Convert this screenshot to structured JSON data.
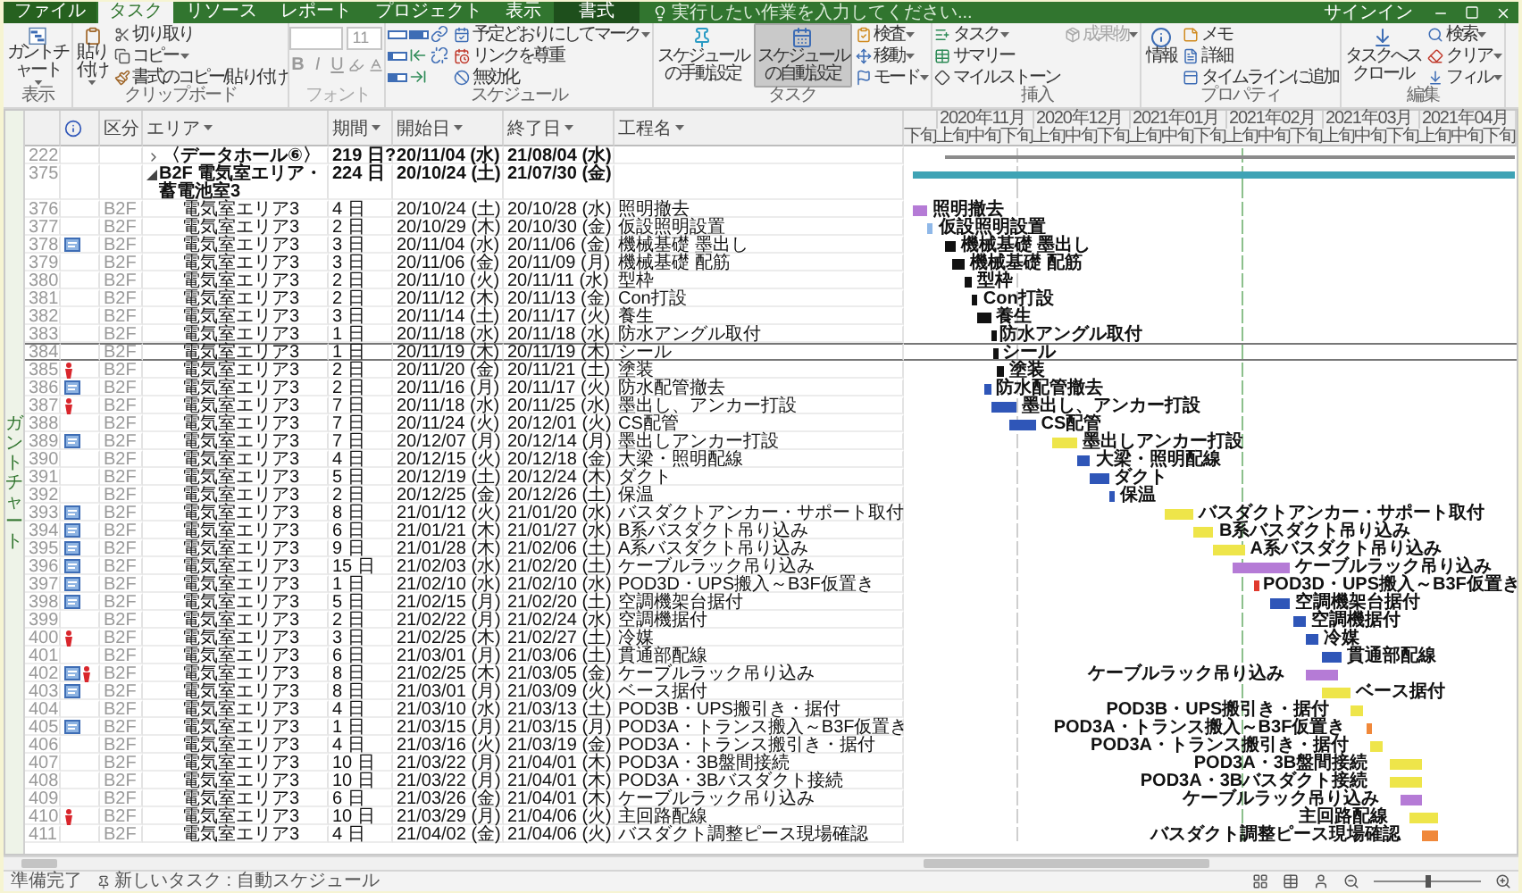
{
  "tabs": [
    {
      "label": "ファイル",
      "kind": "file",
      "selected": false
    },
    {
      "label": "タスク",
      "kind": "standard",
      "selected": true
    },
    {
      "label": "リソース",
      "kind": "standard",
      "selected": false
    },
    {
      "label": "レポート",
      "kind": "standard",
      "selected": false
    },
    {
      "label": "プロジェクト",
      "kind": "standard",
      "selected": false
    },
    {
      "label": "表示",
      "kind": "standard",
      "selected": false
    },
    {
      "label": "書式",
      "kind": "contextual",
      "selected": false
    }
  ],
  "search": {
    "placeholder": "実行したい作業を入力してください..."
  },
  "account": {
    "label": "サインイン"
  },
  "ribbon": {
    "groups": [
      {
        "label": "表示",
        "kind": "commands",
        "items": [
          {
            "kind": "large",
            "label": "ガントチャート",
            "dropdown": true
          }
        ]
      },
      {
        "label": "クリップボード",
        "kind": "commands",
        "items": [
          {
            "kind": "large",
            "label": "貼り付け",
            "dropdown": true
          },
          {
            "kind": "small",
            "label": "切り取り",
            "dropdown": false
          },
          {
            "kind": "small",
            "label": "コピー",
            "dropdown": true
          },
          {
            "kind": "small",
            "label": "書式のコピー/貼り付け",
            "dropdown": false
          }
        ]
      },
      {
        "label": "フォント",
        "kind": "font",
        "disabled": true,
        "items": [
          {
            "kind": "field"
          },
          {
            "kind": "field",
            "value": "11"
          },
          {
            "kind": "style",
            "label": "B"
          },
          {
            "kind": "style",
            "label": "I"
          },
          {
            "kind": "style",
            "label": "U"
          },
          {
            "kind": "icon"
          },
          {
            "kind": "icon"
          }
        ]
      },
      {
        "label": "スケジュール",
        "kind": "commands",
        "items": [
          {
            "kind": "icon"
          },
          {
            "kind": "icon"
          },
          {
            "kind": "icon"
          },
          {
            "kind": "icon"
          },
          {
            "kind": "icon"
          },
          {
            "kind": "icon"
          },
          {
            "kind": "icon"
          },
          {
            "kind": "icon"
          },
          {
            "kind": "small",
            "label": "予定どおりにしてマーク",
            "dropdown": true
          },
          {
            "kind": "small",
            "label": "リンクを尊重",
            "dropdown": false
          },
          {
            "kind": "small",
            "label": "無効化",
            "dropdown": false
          }
        ]
      },
      {
        "label": "タスク",
        "kind": "commands",
        "items": [
          {
            "kind": "large",
            "label": "スケジュールの手動設定",
            "dropdown": false,
            "selected": false
          },
          {
            "kind": "large",
            "label": "スケジュールの自動設定",
            "dropdown": false,
            "selected": true
          },
          {
            "kind": "small",
            "label": "検査",
            "dropdown": true,
            "selected": false
          },
          {
            "kind": "small",
            "label": "移動",
            "dropdown": true,
            "selected": false
          },
          {
            "kind": "small",
            "label": "モード",
            "dropdown": true,
            "selected": false
          }
        ]
      },
      {
        "label": "挿入",
        "kind": "commands",
        "items": [
          {
            "kind": "small",
            "label": "タスク",
            "dropdown": true,
            "disabled": false
          },
          {
            "kind": "small",
            "label": "サマリー",
            "dropdown": false,
            "disabled": false
          },
          {
            "kind": "small",
            "label": "マイルストーン",
            "dropdown": false,
            "disabled": false
          },
          {
            "kind": "small",
            "label": "成果物",
            "dropdown": true,
            "disabled": true
          }
        ]
      },
      {
        "label": "プロパティ",
        "kind": "commands",
        "items": [
          {
            "kind": "large",
            "label": "情報",
            "dropdown": false
          },
          {
            "kind": "small",
            "label": "メモ",
            "dropdown": false
          },
          {
            "kind": "small",
            "label": "詳細",
            "dropdown": false
          },
          {
            "kind": "small",
            "label": "タイムラインに追加",
            "dropdown": false
          }
        ]
      },
      {
        "label": "編集",
        "kind": "commands",
        "items": [
          {
            "kind": "large",
            "label": "タスクへスクロール",
            "dropdown": false
          },
          {
            "kind": "small",
            "label": "検索",
            "dropdown": true
          },
          {
            "kind": "small",
            "label": "クリア",
            "dropdown": true
          },
          {
            "kind": "small",
            "label": "フィル",
            "dropdown": true
          }
        ]
      }
    ]
  },
  "view_bar": {
    "label": "ガントチャート"
  },
  "table": {
    "columns": [
      {
        "kind": "indicator"
      },
      {
        "kind": "text",
        "label": "区分"
      },
      {
        "kind": "text",
        "label": "エリア"
      },
      {
        "kind": "text",
        "label": "期間"
      },
      {
        "kind": "text",
        "label": "開始日"
      },
      {
        "kind": "text",
        "label": "終了日"
      },
      {
        "kind": "text",
        "label": "工程名"
      }
    ],
    "rows": [
      {
        "id": "222",
        "kind": "summary",
        "expanded": false,
        "selected": false,
        "note": false,
        "marked": false,
        "area": "〈データホール⑥〉",
        "duration": "219 日?",
        "start": "20/11/04 (水)",
        "finish": "21/08/04 (水)",
        "color": "#8c8c8c"
      },
      {
        "id": "375",
        "kind": "summary",
        "expanded": true,
        "selected": false,
        "note": false,
        "marked": false,
        "area": "B2F 電気室エリア・蓄電池室3",
        "duration": "224 日",
        "start": "20/10/24 (土)",
        "finish": "21/07/30 (金)",
        "color": "#3fa3b5"
      },
      {
        "id": "376",
        "kind": "task",
        "selected": false,
        "note": false,
        "marked": false,
        "floor": "B2F",
        "area": "電気室エリア3",
        "duration": "4 日",
        "start": "20/10/24 (土)",
        "finish": "20/10/28 (水)",
        "name": "照明撤去",
        "bar_label": "照明撤去",
        "color": "#b57bd6"
      },
      {
        "id": "377",
        "kind": "task",
        "selected": false,
        "note": false,
        "marked": false,
        "floor": "B2F",
        "area": "電気室エリア3",
        "duration": "2 日",
        "start": "20/10/29 (木)",
        "finish": "20/10/30 (金)",
        "name": "仮設照明設置",
        "bar_label": "仮設照明設置",
        "color": "#8fb8e8"
      },
      {
        "id": "378",
        "kind": "task",
        "selected": false,
        "note": true,
        "marked": false,
        "floor": "B2F",
        "area": "電気室エリア3",
        "duration": "3 日",
        "start": "20/11/04 (水)",
        "finish": "20/11/06 (金)",
        "name": "機械基礎 墨出し",
        "bar_label": "機械基礎 墨出し",
        "color": "#111111"
      },
      {
        "id": "379",
        "kind": "task",
        "selected": false,
        "note": false,
        "marked": false,
        "floor": "B2F",
        "area": "電気室エリア3",
        "duration": "3 日",
        "start": "20/11/06 (金)",
        "finish": "20/11/09 (月)",
        "name": "機械基礎 配筋",
        "bar_label": "機械基礎 配筋",
        "color": "#111111"
      },
      {
        "id": "380",
        "kind": "task",
        "selected": false,
        "note": false,
        "marked": false,
        "floor": "B2F",
        "area": "電気室エリア3",
        "duration": "2 日",
        "start": "20/11/10 (火)",
        "finish": "20/11/11 (水)",
        "name": "型枠",
        "bar_label": "型枠",
        "color": "#111111"
      },
      {
        "id": "381",
        "kind": "task",
        "selected": false,
        "note": false,
        "marked": false,
        "floor": "B2F",
        "area": "電気室エリア3",
        "duration": "2 日",
        "start": "20/11/12 (木)",
        "finish": "20/11/13 (金)",
        "name": "Con打設",
        "bar_label": "Con打設",
        "color": "#111111"
      },
      {
        "id": "382",
        "kind": "task",
        "selected": false,
        "note": false,
        "marked": false,
        "floor": "B2F",
        "area": "電気室エリア3",
        "duration": "3 日",
        "start": "20/11/14 (土)",
        "finish": "20/11/17 (火)",
        "name": "養生",
        "bar_label": "養生",
        "color": "#111111"
      },
      {
        "id": "383",
        "kind": "task",
        "selected": false,
        "note": false,
        "marked": false,
        "floor": "B2F",
        "area": "電気室エリア3",
        "duration": "1 日",
        "start": "20/11/18 (水)",
        "finish": "20/11/18 (水)",
        "name": "防水アングル取付",
        "bar_label": "防水アングル取付",
        "color": "#111111"
      },
      {
        "id": "384",
        "kind": "task",
        "selected": true,
        "note": false,
        "marked": false,
        "floor": "B2F",
        "area": "電気室エリア3",
        "duration": "1 日",
        "start": "20/11/19 (木)",
        "finish": "20/11/19 (木)",
        "name": "シール",
        "bar_label": "シール",
        "color": "#111111"
      },
      {
        "id": "385",
        "kind": "task",
        "selected": false,
        "note": false,
        "marked": true,
        "floor": "B2F",
        "area": "電気室エリア3",
        "duration": "2 日",
        "start": "20/11/20 (金)",
        "finish": "20/11/21 (土)",
        "name": "塗装",
        "bar_label": "塗装",
        "color": "#111111"
      },
      {
        "id": "386",
        "kind": "task",
        "selected": false,
        "note": true,
        "marked": false,
        "floor": "B2F",
        "area": "電気室エリア3",
        "duration": "2 日",
        "start": "20/11/16 (月)",
        "finish": "20/11/17 (火)",
        "name": "防水配管撤去",
        "bar_label": "防水配管撤去",
        "color": "#2f56b8"
      },
      {
        "id": "387",
        "kind": "task",
        "selected": false,
        "note": false,
        "marked": true,
        "floor": "B2F",
        "area": "電気室エリア3",
        "duration": "7 日",
        "start": "20/11/18 (水)",
        "finish": "20/11/25 (水)",
        "name": "墨出し、アンカー打設",
        "bar_label": "墨出し、アンカー打設",
        "color": "#2f56b8"
      },
      {
        "id": "388",
        "kind": "task",
        "selected": false,
        "note": false,
        "marked": false,
        "floor": "B2F",
        "area": "電気室エリア3",
        "duration": "7 日",
        "start": "20/11/24 (火)",
        "finish": "20/12/01 (火)",
        "name": "CS配管",
        "bar_label": "CS配管",
        "color": "#2f56b8"
      },
      {
        "id": "389",
        "kind": "task",
        "selected": false,
        "note": true,
        "marked": false,
        "floor": "B2F",
        "area": "電気室エリア3",
        "duration": "7 日",
        "start": "20/12/07 (月)",
        "finish": "20/12/14 (月)",
        "name": "墨出しアンカー打設",
        "bar_label": "墨出しアンカー打設",
        "color": "#eee54a"
      },
      {
        "id": "390",
        "kind": "task",
        "selected": false,
        "note": false,
        "marked": false,
        "floor": "B2F",
        "area": "電気室エリア3",
        "duration": "4 日",
        "start": "20/12/15 (火)",
        "finish": "20/12/18 (金)",
        "name": "大梁・照明配線",
        "bar_label": "大梁・照明配線",
        "color": "#2f56b8"
      },
      {
        "id": "391",
        "kind": "task",
        "selected": false,
        "note": false,
        "marked": false,
        "floor": "B2F",
        "area": "電気室エリア3",
        "duration": "5 日",
        "start": "20/12/19 (土)",
        "finish": "20/12/24 (木)",
        "name": "ダクト",
        "bar_label": "ダクト",
        "color": "#2f56b8"
      },
      {
        "id": "392",
        "kind": "task",
        "selected": false,
        "note": false,
        "marked": false,
        "floor": "B2F",
        "area": "電気室エリア3",
        "duration": "2 日",
        "start": "20/12/25 (金)",
        "finish": "20/12/26 (土)",
        "name": "保温",
        "bar_label": "保温",
        "color": "#2f56b8"
      },
      {
        "id": "393",
        "kind": "task",
        "selected": false,
        "note": true,
        "marked": false,
        "floor": "B2F",
        "area": "電気室エリア3",
        "duration": "8 日",
        "start": "21/01/12 (火)",
        "finish": "21/01/20 (水)",
        "name": "バスダクトアンカー・サポート取付",
        "bar_label": "バスダクトアンカー・サポート取付",
        "color": "#eee54a"
      },
      {
        "id": "394",
        "kind": "task",
        "selected": false,
        "note": true,
        "marked": false,
        "floor": "B2F",
        "area": "電気室エリア3",
        "duration": "6 日",
        "start": "21/01/21 (木)",
        "finish": "21/01/27 (水)",
        "name": "B系バスダクト吊り込み",
        "bar_label": "B系バスダクト吊り込み",
        "color": "#eee54a"
      },
      {
        "id": "395",
        "kind": "task",
        "selected": false,
        "note": true,
        "marked": false,
        "floor": "B2F",
        "area": "電気室エリア3",
        "duration": "9 日",
        "start": "21/01/28 (木)",
        "finish": "21/02/06 (土)",
        "name": "A系バスダクト吊り込み",
        "bar_label": "A系バスダクト吊り込み",
        "color": "#eee54a"
      },
      {
        "id": "396",
        "kind": "task",
        "selected": false,
        "note": true,
        "marked": false,
        "floor": "B2F",
        "area": "電気室エリア3",
        "duration": "15 日",
        "start": "21/02/03 (水)",
        "finish": "21/02/20 (土)",
        "name": "ケーブルラック吊り込み",
        "bar_label": "ケーブルラック吊り込み",
        "color": "#b57bd6"
      },
      {
        "id": "397",
        "kind": "task",
        "selected": false,
        "note": true,
        "marked": false,
        "floor": "B2F",
        "area": "電気室エリア3",
        "duration": "1 日",
        "start": "21/02/10 (水)",
        "finish": "21/02/10 (水)",
        "name": "POD3D・UPS搬入～B3F仮置き",
        "bar_label": "POD3D・UPS搬入～B3F仮置き",
        "color": "#e03a2e"
      },
      {
        "id": "398",
        "kind": "task",
        "selected": false,
        "note": true,
        "marked": false,
        "floor": "B2F",
        "area": "電気室エリア3",
        "duration": "5 日",
        "start": "21/02/15 (月)",
        "finish": "21/02/20 (土)",
        "name": "空調機架台据付",
        "bar_label": "空調機架台据付",
        "color": "#2f56b8"
      },
      {
        "id": "399",
        "kind": "task",
        "selected": false,
        "note": false,
        "marked": false,
        "floor": "B2F",
        "area": "電気室エリア3",
        "duration": "2 日",
        "start": "21/02/22 (月)",
        "finish": "21/02/24 (水)",
        "name": "空調機据付",
        "bar_label": "空調機据付",
        "color": "#2f56b8"
      },
      {
        "id": "400",
        "kind": "task",
        "selected": false,
        "note": false,
        "marked": true,
        "floor": "B2F",
        "area": "電気室エリア3",
        "duration": "3 日",
        "start": "21/02/25 (木)",
        "finish": "21/02/27 (土)",
        "name": "冷媒",
        "bar_label": "冷媒",
        "color": "#2f56b8"
      },
      {
        "id": "401",
        "kind": "task",
        "selected": false,
        "note": false,
        "marked": false,
        "floor": "B2F",
        "area": "電気室エリア3",
        "duration": "6 日",
        "start": "21/03/01 (月)",
        "finish": "21/03/06 (土)",
        "name": "貫通部配線",
        "bar_label": "貫通部配線",
        "color": "#2f56b8"
      },
      {
        "id": "402",
        "kind": "task",
        "selected": false,
        "note": true,
        "marked": true,
        "floor": "B2F",
        "area": "電気室エリア3",
        "duration": "8 日",
        "start": "21/02/25 (木)",
        "finish": "21/03/05 (金)",
        "name": "ケーブルラック吊り込み",
        "bar_label": "ケーブルラック吊り込み",
        "color": "#b57bd6"
      },
      {
        "id": "403",
        "kind": "task",
        "selected": false,
        "note": true,
        "marked": false,
        "floor": "B2F",
        "area": "電気室エリア3",
        "duration": "8 日",
        "start": "21/03/01 (月)",
        "finish": "21/03/09 (火)",
        "name": "ベース据付",
        "bar_label": "ベース据付",
        "color": "#eee54a"
      },
      {
        "id": "404",
        "kind": "task",
        "selected": false,
        "note": false,
        "marked": false,
        "floor": "B2F",
        "area": "電気室エリア3",
        "duration": "4 日",
        "start": "21/03/10 (水)",
        "finish": "21/03/13 (土)",
        "name": "POD3B・UPS搬引き・据付",
        "bar_label": "POD3B・UPS搬引き・据付",
        "color": "#eee54a"
      },
      {
        "id": "405",
        "kind": "task",
        "selected": false,
        "note": true,
        "marked": false,
        "floor": "B2F",
        "area": "電気室エリア3",
        "duration": "1 日",
        "start": "21/03/15 (月)",
        "finish": "21/03/15 (月)",
        "name": "POD3A・トランス搬入～B3F仮置き",
        "bar_label": "POD3A・トランス搬入～B3F仮置き",
        "color": "#f0883a"
      },
      {
        "id": "406",
        "kind": "task",
        "selected": false,
        "note": false,
        "marked": false,
        "floor": "B2F",
        "area": "電気室エリア3",
        "duration": "4 日",
        "start": "21/03/16 (火)",
        "finish": "21/03/19 (金)",
        "name": "POD3A・トランス搬引き・据付",
        "bar_label": "POD3A・トランス搬引き・据付",
        "color": "#eee54a"
      },
      {
        "id": "407",
        "kind": "task",
        "selected": false,
        "note": false,
        "marked": false,
        "floor": "B2F",
        "area": "電気室エリア3",
        "duration": "10 日",
        "start": "21/03/22 (月)",
        "finish": "21/04/01 (木)",
        "name": "POD3A・3B盤間接続",
        "bar_label": "POD3A・3B盤間接続",
        "color": "#eee54a"
      },
      {
        "id": "408",
        "kind": "task",
        "selected": false,
        "note": false,
        "marked": false,
        "floor": "B2F",
        "area": "電気室エリア3",
        "duration": "10 日",
        "start": "21/03/22 (月)",
        "finish": "21/04/01 (木)",
        "name": "POD3A・3Bバスダクト接続",
        "bar_label": "POD3A・3Bバスダクト接続",
        "color": "#eee54a"
      },
      {
        "id": "409",
        "kind": "task",
        "selected": false,
        "note": false,
        "marked": false,
        "floor": "B2F",
        "area": "電気室エリア3",
        "duration": "6 日",
        "start": "21/03/26 (金)",
        "finish": "21/04/01 (木)",
        "name": "ケーブルラック吊り込み",
        "bar_label": "ケーブルラック吊り込み",
        "color": "#b57bd6"
      },
      {
        "id": "410",
        "kind": "task",
        "selected": false,
        "note": false,
        "marked": true,
        "floor": "B2F",
        "area": "電気室エリア3",
        "duration": "10 日",
        "start": "21/03/29 (月)",
        "finish": "21/04/06 (火)",
        "name": "主回路配線",
        "bar_label": "主回路配線",
        "color": "#eee54a"
      },
      {
        "id": "411",
        "kind": "task",
        "selected": false,
        "note": false,
        "marked": false,
        "floor": "B2F",
        "area": "電気室エリア3",
        "duration": "4 日",
        "start": "21/04/02 (金)",
        "finish": "21/04/06 (火)",
        "name": "バスダクト調整ピース現場確認",
        "bar_label": "バスダクト調整ピース現場確認",
        "color": "#f0883a"
      }
    ]
  },
  "gantt": {
    "months": [
      "2020年11月",
      "2020年12月",
      "2021年01月",
      "2021年02月",
      "2021年03月",
      "2021年04月"
    ],
    "periods": [
      "下旬",
      "上旬",
      "中旬",
      "下旬",
      "上旬",
      "中旬",
      "下旬",
      "上旬",
      "中旬",
      "下旬",
      "上旬",
      "中旬",
      "下旬",
      "上旬",
      "中旬",
      "下旬",
      "上旬",
      "中旬",
      "下旬"
    ]
  },
  "status_bar": {
    "mode": "準備完了",
    "new_tasks": "新しいタスク : 自動スケジュール",
    "zoom": {
      "level": 0.5
    }
  }
}
